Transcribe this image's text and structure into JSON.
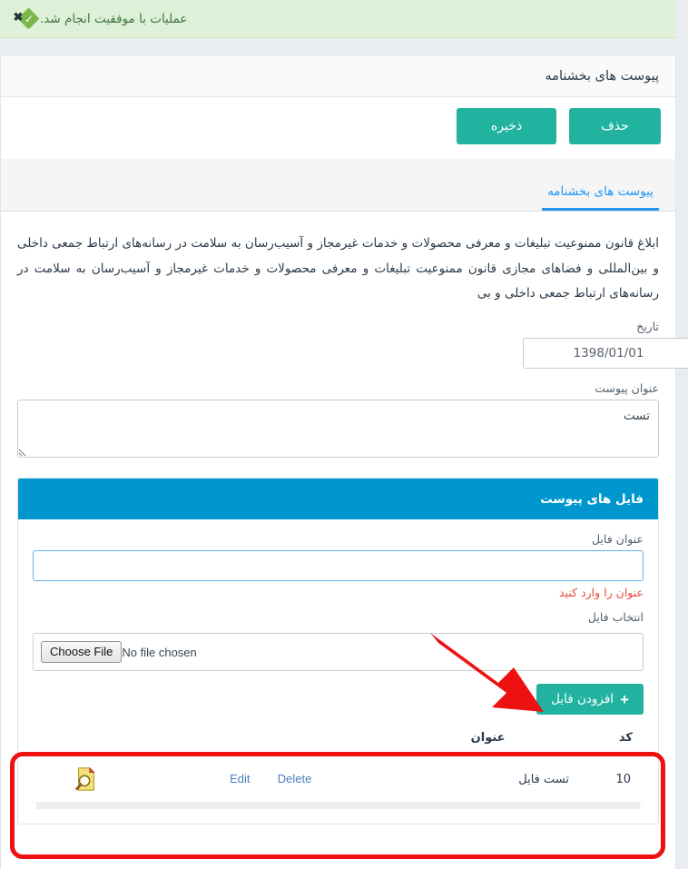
{
  "alert": {
    "message": "عملیات با موفقیت انجام شد.",
    "icon": "success-check-icon",
    "close_label": "✖",
    "bg_color": "#dff0d8",
    "text_color": "#3c763d",
    "icon_color": "#7ab648"
  },
  "header": {
    "title": "پیوست های بخشنامه"
  },
  "toolbar": {
    "save_label": "ذخیره",
    "delete_label": "حذف",
    "button_color": "#22b3a0"
  },
  "tabs": [
    {
      "label": "پیوست های بخشنامه",
      "active": true,
      "color": "#2196f3"
    }
  ],
  "description": "ابلاغ قانون ممنوعیت تبلیغات و معرفی محصولات و خدمات غیرمجاز و آسیب‌رسان به سلامت در رسانه‌های ارتباط جمعی داخلی و بین‌المللی و فضاهای مجازی قانون ممنوعیت تبلیغات و معرفی محصولات و خدمات غیرمجاز و آسیب‌رسان به سلامت در رسانه‌های ارتباط جمعی داخلی و بی",
  "fields": {
    "date": {
      "label": "تاریخ",
      "value": "1398/01/01",
      "placeholder": "",
      "icon": "calendar-icon"
    },
    "attachment_title": {
      "label": "عنوان پیوست",
      "value": "تست",
      "placeholder": ""
    }
  },
  "files_panel": {
    "title": "فایل های پیوست",
    "header_color": "#0097cf",
    "file_title": {
      "label": "عنوان فایل",
      "value": "",
      "placeholder": "",
      "error": "عنوان را وارد کنید",
      "error_color": "#e74c3c"
    },
    "file_select": {
      "label": "انتخاب فایل",
      "button_label": "Choose File",
      "status_text": "No file chosen"
    },
    "add_button": {
      "label": "افزودن فایل",
      "plus": "+"
    },
    "table": {
      "columns": [
        "کد",
        "عنوان",
        "",
        ""
      ],
      "rows": [
        {
          "code": "10",
          "title": "تست فایل",
          "edit_label": "Edit",
          "delete_label": "Delete",
          "icon": "document-preview-icon"
        }
      ]
    }
  },
  "annotations": {
    "arrow": {
      "color": "#ee1111",
      "points_to": "افزودن فایل"
    },
    "rectangle": {
      "color": "#ee1111",
      "surrounds": "files-table"
    }
  }
}
